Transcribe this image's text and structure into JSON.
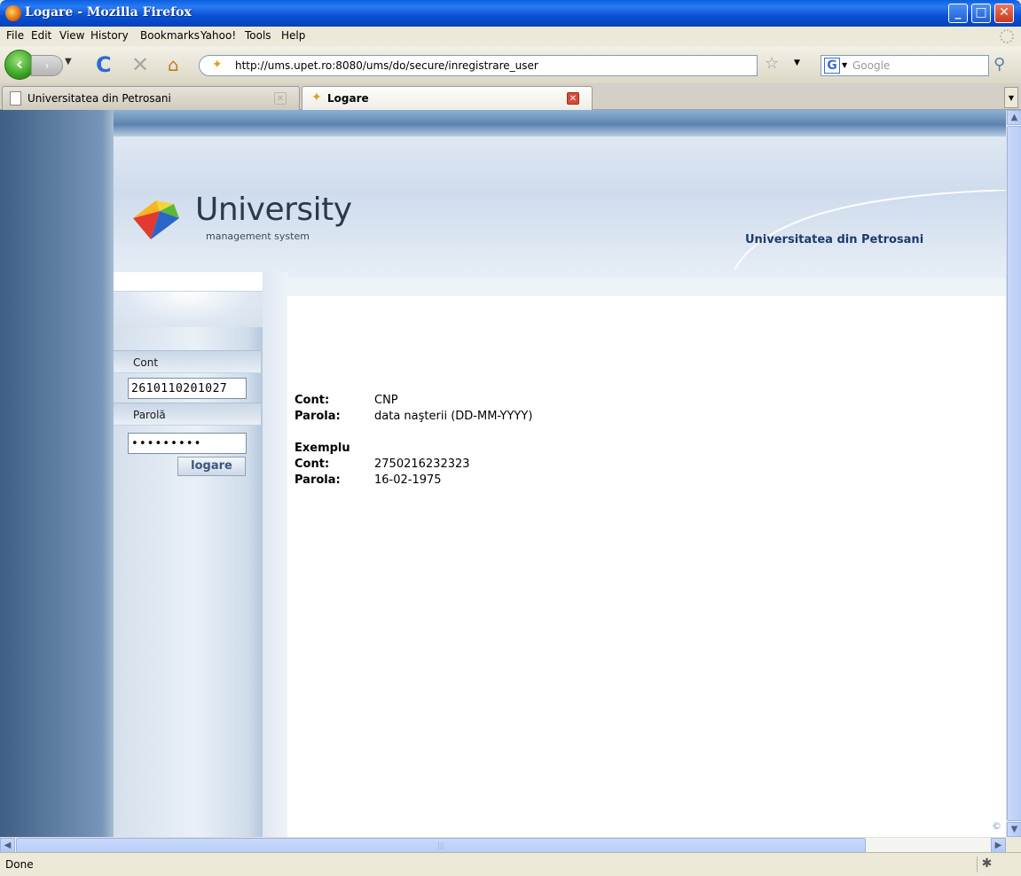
{
  "window": {
    "title": "Logare - Mozilla Firefox",
    "min": "_",
    "max": "□",
    "close": "✕"
  },
  "menu": {
    "file": "File",
    "edit": "Edit",
    "view": "View",
    "history": "History",
    "bookmarks": "Bookmarks",
    "yahoo": "Yahoo!",
    "tools": "Tools",
    "help": "Help"
  },
  "nav": {
    "back": "‹",
    "forward": "›",
    "reload": "C",
    "stop": "✕",
    "home": "⌂",
    "url": "http://ums.upet.ro:8080/ums/do/secure/inregistrare_user",
    "search_engine": "G",
    "search_placeholder": "Google"
  },
  "tabs": [
    {
      "label": "Universitatea din Petrosani",
      "active": false
    },
    {
      "label": "Logare",
      "active": true
    }
  ],
  "header": {
    "logo_title": "University",
    "logo_subtitle": "management system",
    "university_name": "Universitatea din Petrosani"
  },
  "login": {
    "account_label": "Cont",
    "account_value": "2610110201027",
    "password_label": "Parolă",
    "password_value": "•••••••••",
    "submit_label": "logare"
  },
  "instructions": {
    "account_label": "Cont:",
    "account_value": "CNP",
    "password_label": "Parola:",
    "password_value": "data naşterii (DD-MM-YYYY)",
    "example_heading": "Exemplu",
    "example_account_label": "Cont:",
    "example_account_value": "2750216232323",
    "example_password_label": "Parola:",
    "example_password_value": "16-02-1975"
  },
  "status": {
    "text": "Done"
  },
  "colors": {
    "brand_blue": "#1c3b6b",
    "xp_title_blue": "#0a5fe0",
    "button_text": "#3a5680"
  }
}
